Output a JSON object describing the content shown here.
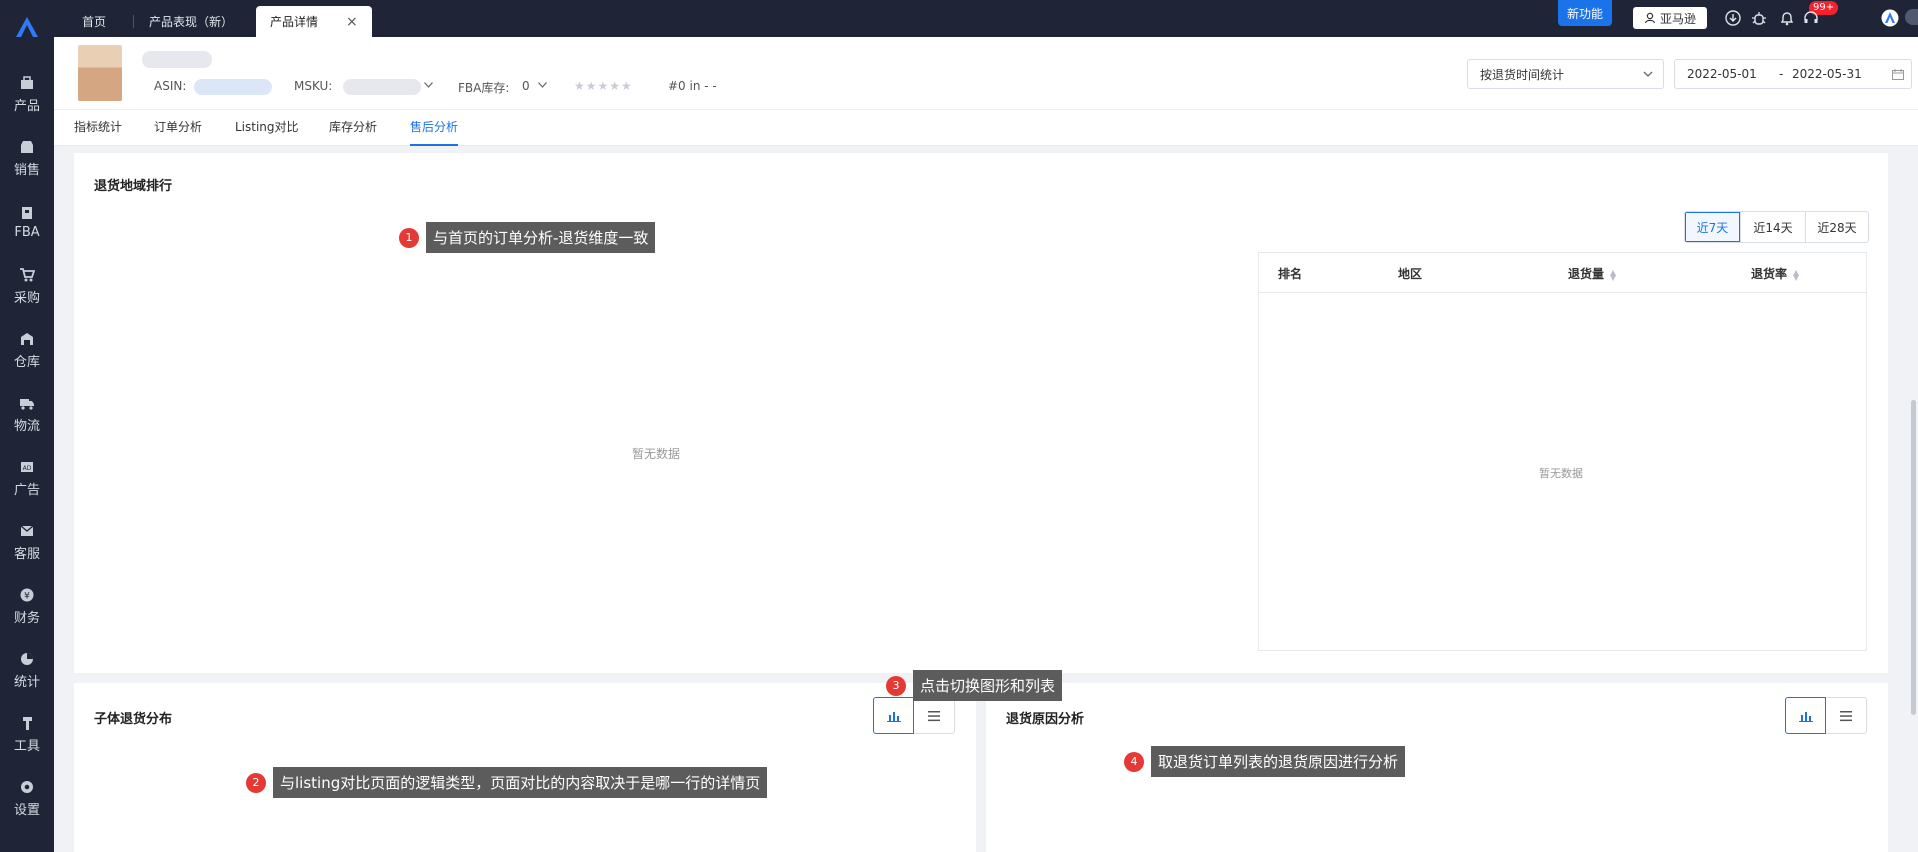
{
  "sidebar": {
    "items": [
      {
        "label": "产品",
        "icon": "product-icon"
      },
      {
        "label": "销售",
        "icon": "sales-icon"
      },
      {
        "label": "FBA",
        "icon": "fba-icon"
      },
      {
        "label": "采购",
        "icon": "purchase-cart-icon"
      },
      {
        "label": "仓库",
        "icon": "warehouse-icon"
      },
      {
        "label": "物流",
        "icon": "truck-icon"
      },
      {
        "label": "广告",
        "icon": "ad-icon"
      },
      {
        "label": "客服",
        "icon": "mail-icon"
      },
      {
        "label": "财务",
        "icon": "yen-icon"
      },
      {
        "label": "统计",
        "icon": "pie-chart-icon"
      },
      {
        "label": "工具",
        "icon": "wrench-icon"
      },
      {
        "label": "设置",
        "icon": "settings-icon"
      }
    ]
  },
  "topbar": {
    "tabs": [
      {
        "label": "首页"
      },
      {
        "label": "产品表现（新）"
      },
      {
        "label": "产品详情"
      }
    ],
    "close_label": "×",
    "new_feature": "新功能",
    "amazon_label": "亚马逊",
    "badge": "99+"
  },
  "product": {
    "asin_label": "ASIN:",
    "msku_label": "MSKU:",
    "fba_label": "FBA库存:",
    "fba_value": "0",
    "rank": "#0 in - -"
  },
  "filters": {
    "stat_mode": "按退货时间统计",
    "date_start": "2022-05-01",
    "date_sep": "-",
    "date_end": "2022-05-31"
  },
  "subtabs": [
    {
      "label": "指标统计"
    },
    {
      "label": "订单分析"
    },
    {
      "label": "Listing对比"
    },
    {
      "label": "库存分析"
    },
    {
      "label": "售后分析"
    }
  ],
  "region": {
    "title": "退货地域排行",
    "empty": "暂无数据",
    "range_options": [
      "近7天",
      "近14天",
      "近28天"
    ],
    "table": {
      "headers": [
        "排名",
        "地区",
        "退货量",
        "退货率"
      ],
      "empty": "暂无数据"
    }
  },
  "sub_panels": {
    "child_title": "子体退货分布",
    "reason_title": "退货原因分析"
  },
  "annotations": [
    {
      "num": "1",
      "text": "与首页的订单分析-退货维度一致"
    },
    {
      "num": "2",
      "text": "与listing对比页面的逻辑类型，页面对比的内容取决于是哪一行的详情页"
    },
    {
      "num": "3",
      "text": "点击切换图形和列表"
    },
    {
      "num": "4",
      "text": "取退货订单列表的退货原因进行分析"
    }
  ],
  "colors": {
    "sidebar_bg": "#1f2536",
    "accent": "#1a73e8",
    "annotation_badge": "#e53935",
    "annotation_box": "#5c5c5c"
  }
}
